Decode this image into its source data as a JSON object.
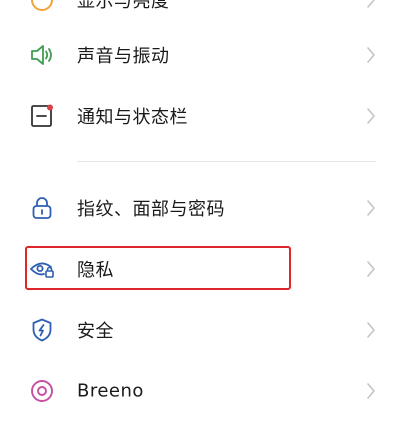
{
  "settings": {
    "items": [
      {
        "label": "显示与亮度",
        "icon": "display-brightness-icon"
      },
      {
        "label": "声音与振动",
        "icon": "speaker-icon"
      },
      {
        "label": "通知与状态栏",
        "icon": "notification-icon"
      },
      {
        "label": "指纹、面部与密码",
        "icon": "lock-icon"
      },
      {
        "label": "隐私",
        "icon": "privacy-eye-lock-icon"
      },
      {
        "label": "安全",
        "icon": "shield-icon"
      },
      {
        "label": "Breeno",
        "icon": "breeno-icon"
      }
    ]
  },
  "colors": {
    "highlight_border": "#e0262b",
    "sound_icon": "#3f9c50",
    "notification_icon": "#d9414a",
    "security_icon": "#2f5fb3",
    "breeno_icon": "#c64fa2"
  }
}
